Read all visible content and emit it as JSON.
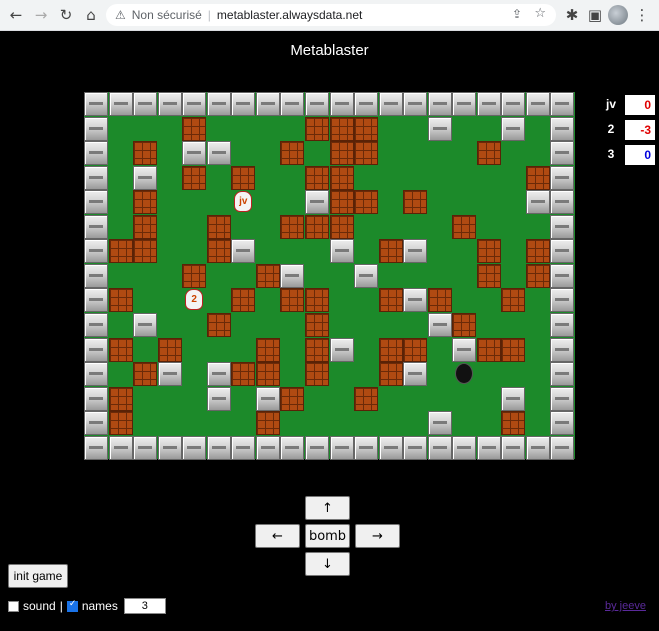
{
  "browser": {
    "insecure_label": "Non sécurisé",
    "url": "metablaster.alwaysdata.net"
  },
  "page": {
    "title": "Metablaster"
  },
  "game": {
    "players": [
      {
        "label": "jv",
        "kind": "white"
      },
      {
        "label": "2",
        "kind": "white"
      },
      {
        "label": "",
        "kind": "black"
      }
    ]
  },
  "scores": [
    {
      "name": "jv",
      "value": "0",
      "color": "#e00000"
    },
    {
      "name": "2",
      "value": "-3",
      "color": "#e00000"
    },
    {
      "name": "3",
      "value": "0",
      "color": "#0000dd"
    }
  ],
  "controls": {
    "up": "↑",
    "left": "←",
    "bomb": "bomb",
    "right": "→",
    "down": "↓",
    "init": "init game",
    "sound_label": "sound",
    "separator": "|",
    "names_label": "names",
    "names_count": "3",
    "credit": "by jeeve"
  }
}
